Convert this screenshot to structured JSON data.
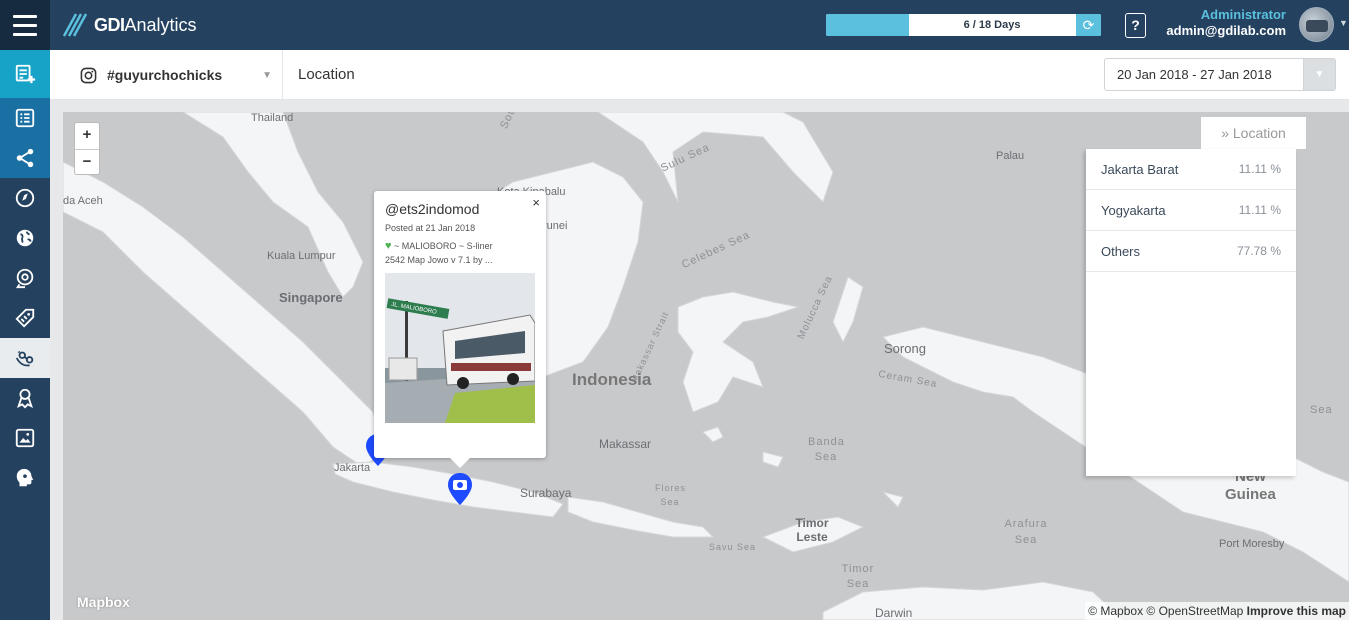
{
  "app": {
    "title_bold": "GDI",
    "title_rest": "Analytics"
  },
  "quota": {
    "text": "6 / 18 Days",
    "used_fraction": 0.333
  },
  "help": {
    "label": "?"
  },
  "user": {
    "role": "Administrator",
    "email": "admin@gdilab.com"
  },
  "sidebar": {
    "items": [
      {
        "icon": "add-report-icon"
      },
      {
        "icon": "list-icon"
      },
      {
        "icon": "share-icon"
      },
      {
        "icon": "compass-icon"
      },
      {
        "icon": "globe-icon"
      },
      {
        "icon": "chat-search-icon"
      },
      {
        "icon": "tag-icon"
      },
      {
        "icon": "location-icon",
        "active": true
      },
      {
        "icon": "influencer-icon"
      },
      {
        "icon": "image-icon"
      },
      {
        "icon": "head-icon"
      }
    ]
  },
  "toolbar": {
    "account": "#guyurchochicks",
    "page_title": "Location",
    "date_range": "20 Jan 2018 - 27 Jan 2018"
  },
  "map": {
    "zoom_in": "+",
    "zoom_out": "−",
    "logo": "Mapbox",
    "attribution_a": "© Mapbox © OpenStreetMap",
    "attribution_b": "Improve this map",
    "labels": {
      "thailand": "Thailand",
      "aceh": "da Aceh",
      "kuala_lumpur": "Kuala Lumpur",
      "singapore": "Singapore",
      "kota_kinabalu": "Kota Kinabalu",
      "brunei": "runei",
      "sulu_sea": "Sulu Sea",
      "celebes_sea": "Celebes Sea",
      "palau": "Palau",
      "makassar_strait": "Makassar Strait",
      "molucca_sea": "Molucca Sea",
      "indonesia": "Indonesia",
      "sorong": "Sorong",
      "ceram_sea": "Ceram Sea",
      "makassar": "Makassar",
      "banda_sea": "Banda Sea",
      "jakarta": "Jakarta",
      "surabaya": "Surabaya",
      "flores_sea": "Flores Sea",
      "timor_leste": "Timor Leste",
      "savu_sea": "Savu Sea",
      "arafura_sea": "Arafura Sea",
      "timor_sea": "Timor Sea",
      "darwin": "Darwin",
      "new_guinea_a": "New",
      "new_guinea_b": "Guinea",
      "port_moresby": "Port Moresby",
      "sea_right": "Sea",
      "south": "Sou"
    }
  },
  "popup": {
    "handle": "@ets2indomod",
    "posted": "Posted at 21 Jan 2018",
    "caption_line1": "~ MALIOBORO ~ S-liner",
    "caption_line2": "2542 Map Jowo v 7.1 by ...",
    "close": "×",
    "photo_sign": "JL. MALIOBORO"
  },
  "location_panel": {
    "tab_label": "Location",
    "rows": [
      {
        "name": "Jakarta Barat",
        "pct": "11.11 %"
      },
      {
        "name": "Yogyakarta",
        "pct": "11.11 %"
      },
      {
        "name": "Others",
        "pct": "77.78 %"
      }
    ]
  }
}
